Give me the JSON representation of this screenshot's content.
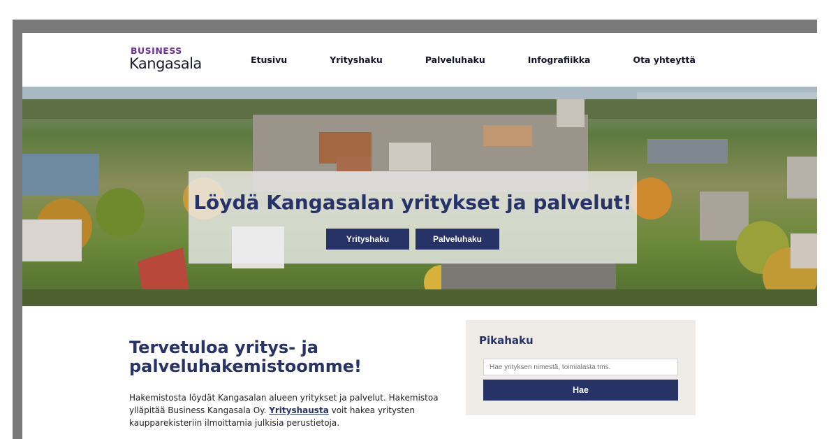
{
  "logo": {
    "top": "BUSINESS",
    "bottom": "Kangasala"
  },
  "nav": {
    "items": [
      {
        "label": "Etusivu"
      },
      {
        "label": "Yrityshaku"
      },
      {
        "label": "Palveluhaku"
      },
      {
        "label": "Infografiikka"
      },
      {
        "label": "Ota yhteyttä"
      }
    ]
  },
  "hero": {
    "title": "Löydä Kangasalan yritykset ja palvelut!",
    "button_company": "Yrityshaku",
    "button_service": "Palveluhaku"
  },
  "welcome": {
    "title": "Tervetuloa yritys- ja palveluhakemistoomme!",
    "text_1": "Hakemistosta löydät Kangasalan alueen yritykset ja palvelut. Hakemistoa ylläpitää Business Kangasala Oy. ",
    "link": "Yrityshausta",
    "text_2": " voit hakea yritysten kaupparekisteriin ilmoittamia julkisia perustietoja."
  },
  "quick_search": {
    "title": "Pikahaku",
    "placeholder": "Hae yrityksen nimestä, toimialasta tms.",
    "button": "Hae"
  },
  "colors": {
    "primary": "#273266",
    "brand_purple": "#6b2f9a",
    "panel_bg": "#efebe6"
  }
}
